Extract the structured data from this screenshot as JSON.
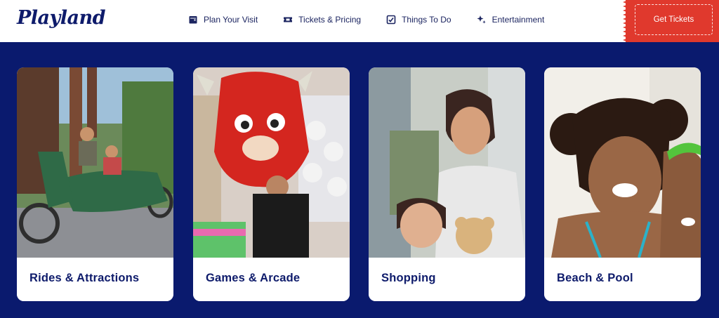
{
  "brand": {
    "logo_text": "Playland"
  },
  "nav": {
    "items": [
      {
        "label": "Plan Your Visit",
        "icon": "calendar-icon"
      },
      {
        "label": "Tickets & Pricing",
        "icon": "ticket-icon"
      },
      {
        "label": "Things To Do",
        "icon": "checklist-icon"
      },
      {
        "label": "Entertainment",
        "icon": "sparkle-icon"
      }
    ],
    "cta_label": "Get Tickets"
  },
  "colors": {
    "navy": "#0a1a6e",
    "brand_text": "#0e1b6b",
    "cta": "#e0392d"
  },
  "cards": [
    {
      "label": "Rides & Attractions"
    },
    {
      "label": "Games & Arcade"
    },
    {
      "label": "Shopping"
    },
    {
      "label": "Beach & Pool"
    }
  ]
}
